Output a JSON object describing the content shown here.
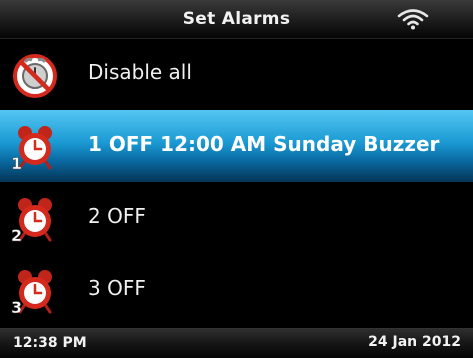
{
  "header": {
    "title": "Set Alarms",
    "wifi_icon": "wifi-icon"
  },
  "menu": {
    "items": [
      {
        "label": "Disable all",
        "icon": "disable-alarm-icon",
        "selected": false
      },
      {
        "label": "1 OFF 12:00 AM Sunday Buzzer",
        "icon": "alarm-clock-icon",
        "alarm_number": "1",
        "selected": true
      },
      {
        "label": "2 OFF",
        "icon": "alarm-clock-icon",
        "alarm_number": "2",
        "selected": false
      },
      {
        "label": "3 OFF",
        "icon": "alarm-clock-icon",
        "alarm_number": "3",
        "selected": false
      }
    ]
  },
  "status": {
    "time": "12:38 PM",
    "date": "24 Jan 2012"
  },
  "colors": {
    "selection": "#1b9ad3",
    "alarm_red": "#d42a1e",
    "background": "#000000"
  }
}
